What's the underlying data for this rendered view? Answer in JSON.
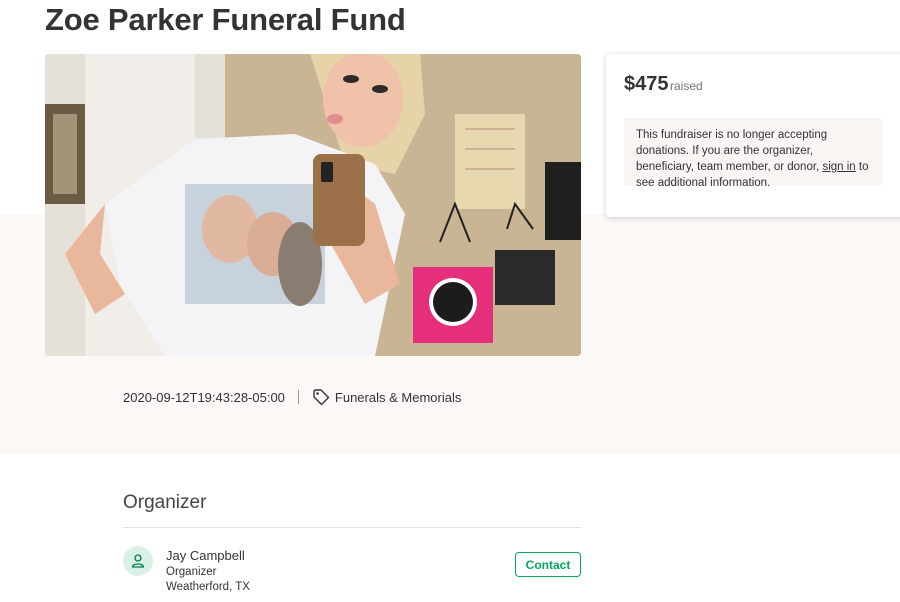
{
  "campaign": {
    "title": "Zoe Parker Funeral Fund",
    "photo_description": "campaign-photo"
  },
  "donation": {
    "amount": "$475",
    "raised_label": "raised",
    "notice_prefix": "This fundraiser is no longer accepting donations. If you are the organizer, beneficiary, team member, or donor, ",
    "sign_in_label": "sign in",
    "notice_suffix": " to see additional information."
  },
  "meta": {
    "created": "2020-09-12T19:43:28-05:00",
    "category": "Funerals & Memorials"
  },
  "organizer": {
    "heading": "Organizer",
    "name": "Jay Campbell",
    "role": "Organizer",
    "location": "Weatherford, TX",
    "contact_label": "Contact"
  },
  "colors": {
    "accent": "#02a95c",
    "band": "#fbf8f6"
  }
}
